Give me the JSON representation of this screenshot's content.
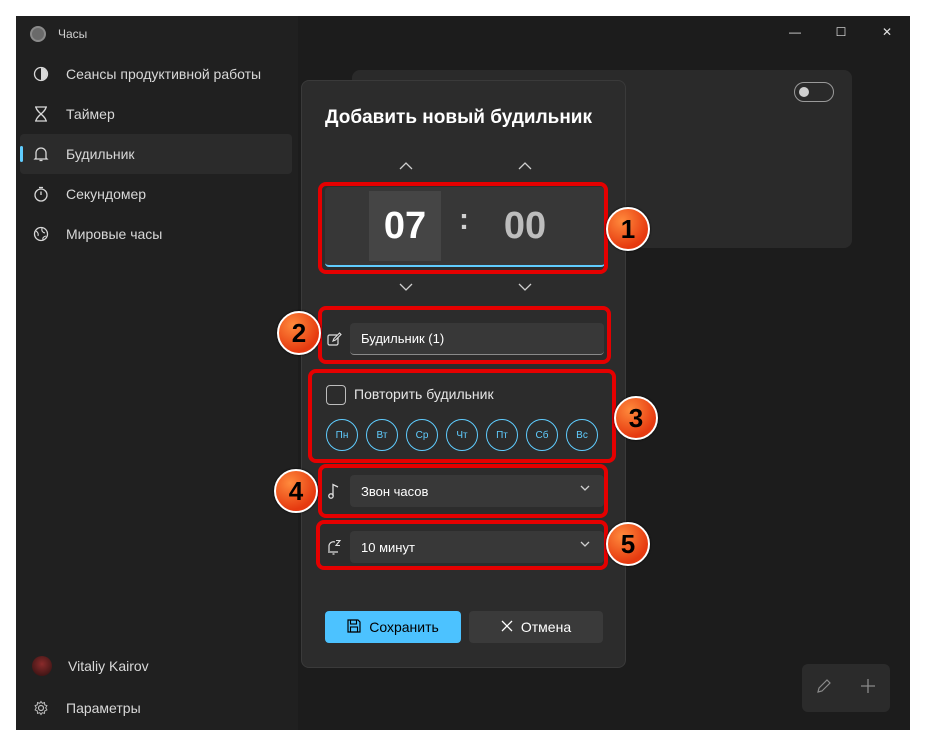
{
  "app": {
    "title": "Часы"
  },
  "window_controls": {
    "minimize": "—",
    "maximize": "☐",
    "close": "✕"
  },
  "sidebar": {
    "items": [
      {
        "label": "Сеансы продуктивной работы",
        "icon": "focus-icon"
      },
      {
        "label": "Таймер",
        "icon": "hourglass-icon"
      },
      {
        "label": "Будильник",
        "icon": "bell-icon",
        "active": true
      },
      {
        "label": "Секундомер",
        "icon": "stopwatch-icon"
      },
      {
        "label": "Мировые часы",
        "icon": "globe-icon"
      }
    ],
    "user": "Vitaliy Kairov",
    "settings": "Параметры"
  },
  "dialog": {
    "title": "Добавить новый будильник",
    "hour": "07",
    "separator": ":",
    "minute": "00",
    "name_value": "Будильник (1)",
    "repeat_label": "Повторить будильник",
    "repeat_checked": false,
    "days": [
      "Пн",
      "Вт",
      "Ср",
      "Чт",
      "Пт",
      "Сб",
      "Вс"
    ],
    "sound": "Звон часов",
    "snooze": "10 минут",
    "save_label": "Сохранить",
    "cancel_label": "Отмена"
  },
  "annotations": [
    "1",
    "2",
    "3",
    "4",
    "5"
  ],
  "colors": {
    "accent": "#60cdff",
    "save_button": "#4cc2ff",
    "highlight": "#e50000",
    "badge": "#f0601e"
  }
}
